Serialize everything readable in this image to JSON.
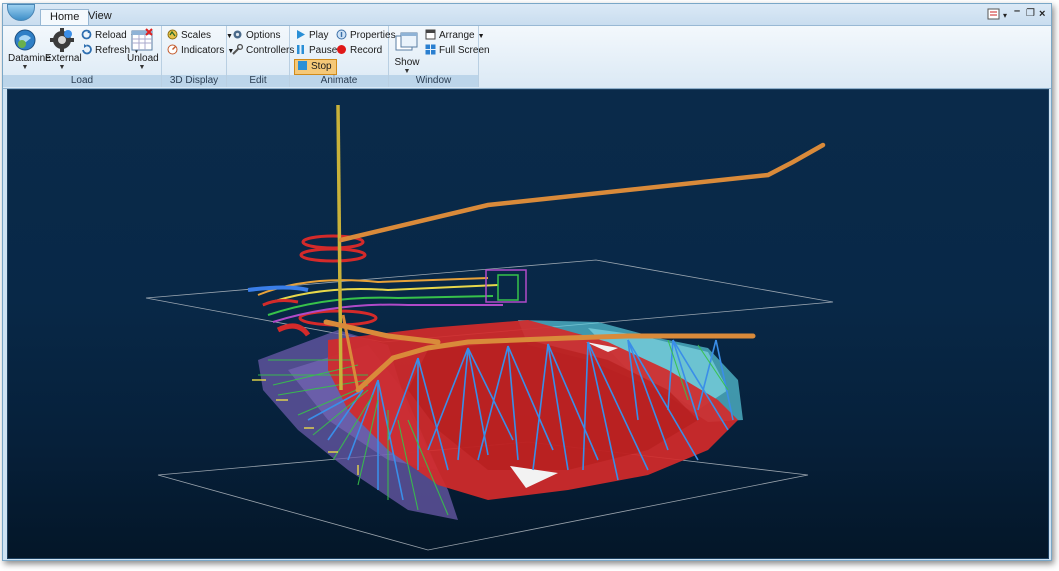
{
  "tabs": [
    {
      "label": "Home",
      "active": true
    },
    {
      "label": "View",
      "active": false
    }
  ],
  "title_bar": {
    "controls": [
      "menu-icon",
      "minimize-icon",
      "restore-icon",
      "close-icon"
    ]
  },
  "ribbon": {
    "groups": {
      "load": {
        "label": "Load",
        "datamine": "Datamine",
        "external": "External",
        "reload": "Reload",
        "refresh": "Refresh",
        "unload": "Unload"
      },
      "display3d": {
        "label": "3D Display",
        "scales": "Scales",
        "indicators": "Indicators"
      },
      "edit": {
        "label": "Edit",
        "options": "Options",
        "controllers": "Controllers"
      },
      "animate": {
        "label": "Animate",
        "play": "Play",
        "properties": "Properties",
        "pause": "Pause",
        "record": "Record",
        "stop": "Stop"
      },
      "window": {
        "label": "Window",
        "show": "Show",
        "arrange": "Arrange",
        "full_screen": "Full Screen"
      }
    }
  },
  "viewport": {
    "background": "#082847",
    "colors": {
      "orebody": "#d42a2a",
      "drift": "#d98a3a",
      "drillhole": "#3a8ee8",
      "stope": "#5fd6e6",
      "hangingwall": "#6a5aa8",
      "shaft": "#c9b23a",
      "grid": "#bfc6cc"
    }
  }
}
